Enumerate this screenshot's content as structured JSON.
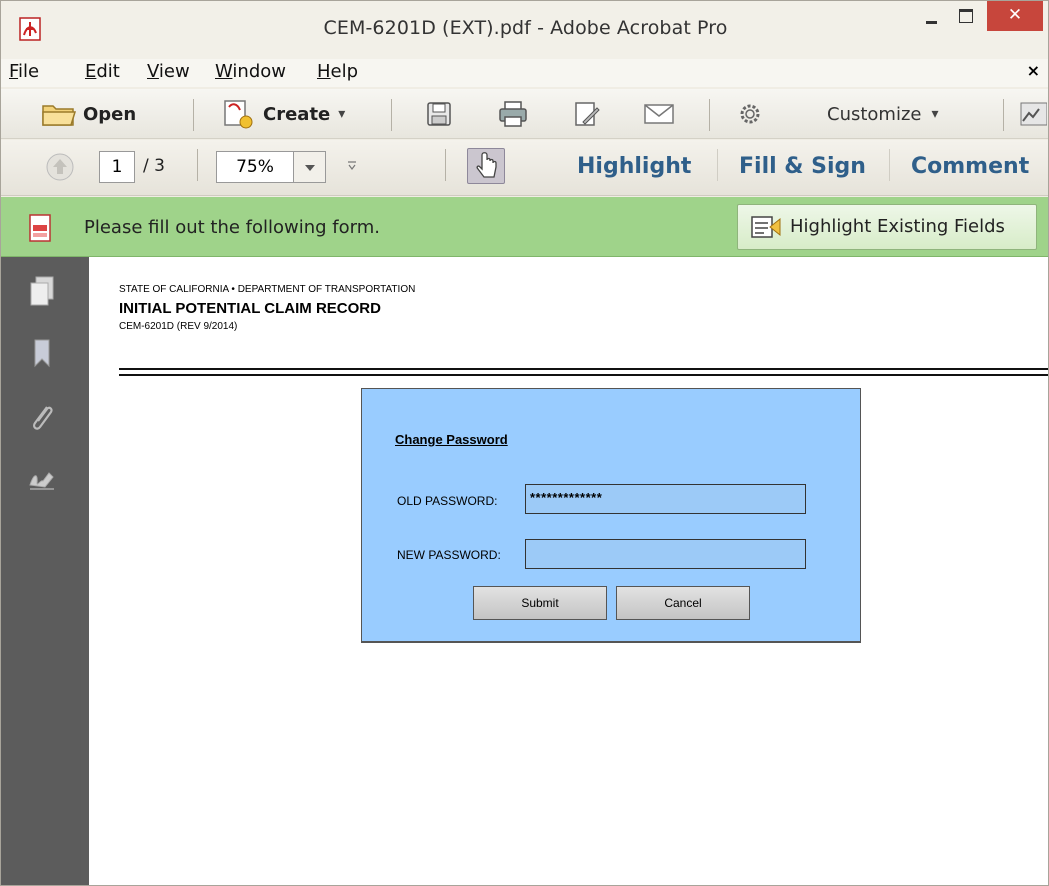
{
  "window": {
    "title": "CEM-6201D (EXT).pdf - Adobe Acrobat Pro",
    "close_glyph": "✕"
  },
  "menu": {
    "items": [
      {
        "label": "File",
        "u": "F",
        "rest": "ile"
      },
      {
        "label": "Edit",
        "u": "E",
        "rest": "dit"
      },
      {
        "label": "View",
        "u": "V",
        "rest": "iew"
      },
      {
        "label": "Window",
        "u": "W",
        "rest": "indow"
      },
      {
        "label": "Help",
        "u": "H",
        "rest": "elp"
      }
    ],
    "close_glyph": "×"
  },
  "toolbar": {
    "open_label": "Open",
    "create_label": "Create",
    "customize_label": "Customize",
    "dropdown_glyph": "▾"
  },
  "nav": {
    "page_current": "1",
    "page_total": "/ 3",
    "zoom": "75%"
  },
  "tasks": {
    "highlight": "Highlight",
    "fill_sign": "Fill & Sign",
    "comment": "Comment"
  },
  "forms_bar": {
    "message": "Please fill out the following form.",
    "highlight_fields_label": "Highlight Existing Fields"
  },
  "document": {
    "agency": "STATE OF CALIFORNIA • DEPARTMENT OF TRANSPORTATION",
    "form_title": "INITIAL POTENTIAL CLAIM RECORD",
    "form_number": "CEM-6201D (REV 9/2014)"
  },
  "dialog": {
    "title": "Change Password",
    "old_label": "OLD PASSWORD:",
    "old_value": "*************",
    "new_label": "NEW PASSWORD:",
    "new_value": "",
    "submit_label": "Submit",
    "cancel_label": "Cancel"
  },
  "colors": {
    "forms_bar_bg": "#9fd38a",
    "dialog_bg": "#99ccff",
    "task_link": "#2f5f8a",
    "close_button": "#c7463c"
  }
}
